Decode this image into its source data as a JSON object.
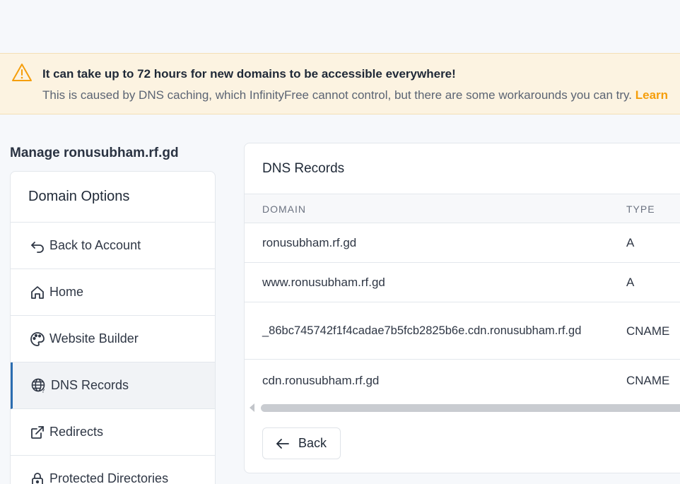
{
  "alert": {
    "title": "It can take up to 72 hours for new domains to be accessible everywhere!",
    "body": "This is caused by DNS caching, which InfinityFree cannot control, but there are some workarounds you can try. ",
    "link": "Learn",
    "icon": "warning-triangle-icon",
    "accent": "#f59e0b"
  },
  "manage_title": "Manage ronusubham.rf.gd",
  "sidebar": {
    "header": "Domain Options",
    "items": [
      {
        "label": "Back to Account",
        "icon": "back-arrow-icon"
      },
      {
        "label": "Home",
        "icon": "home-icon"
      },
      {
        "label": "Website Builder",
        "icon": "palette-icon"
      },
      {
        "label": "DNS Records",
        "icon": "globe-icon",
        "active": true
      },
      {
        "label": "Redirects",
        "icon": "external-link-icon"
      },
      {
        "label": "Protected Directories",
        "icon": "lock-icon"
      }
    ]
  },
  "panel": {
    "title": "DNS Records",
    "columns": {
      "domain": "DOMAIN",
      "type": "TYPE"
    },
    "rows": [
      {
        "domain": "ronusubham.rf.gd",
        "type": "A"
      },
      {
        "domain": "www.ronusubham.rf.gd",
        "type": "A"
      },
      {
        "domain": "_86bc745742f1f4cadae7b5fcb2825b6e.cdn.ronusubham.rf.gd",
        "type": "CNAME"
      },
      {
        "domain": "cdn.ronusubham.rf.gd",
        "type": "CNAME"
      }
    ],
    "back_label": "Back"
  }
}
